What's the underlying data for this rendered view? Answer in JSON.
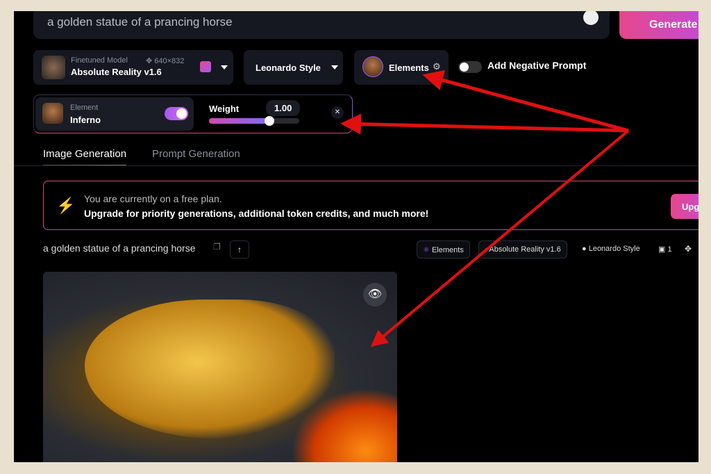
{
  "prompt": {
    "text": "a golden statue of a prancing horse",
    "generate_label": "Generate"
  },
  "model": {
    "caption": "Finetuned Model",
    "dimensions": "640×832",
    "name": "Absolute Reality v1.6"
  },
  "style": {
    "label": "Leonardo Style"
  },
  "elements": {
    "label": "Elements"
  },
  "negative_prompt": {
    "label": "Add Negative Prompt",
    "enabled": false
  },
  "element_card": {
    "caption": "Element",
    "name": "Inferno",
    "enabled": true,
    "weight_label": "Weight",
    "weight_value": "1.00",
    "weight_fraction": 0.67
  },
  "tabs": [
    {
      "label": "Image Generation",
      "active": true
    },
    {
      "label": "Prompt Generation",
      "active": false
    }
  ],
  "banner": {
    "line1": "You are currently on a free plan.",
    "line2": "Upgrade for priority generations, additional token credits, and much more!",
    "button": "Upg"
  },
  "generation": {
    "prompt": "a golden statue of a prancing horse",
    "tags": {
      "elements": "Elements",
      "model": "Absolute Reality v1.6",
      "style": "Leonardo Style",
      "count": "1"
    }
  },
  "colors": {
    "accent_start": "#e8478b",
    "accent_end": "#a855f7",
    "arrow": "#e01010",
    "frame": "#e9e0cf"
  }
}
